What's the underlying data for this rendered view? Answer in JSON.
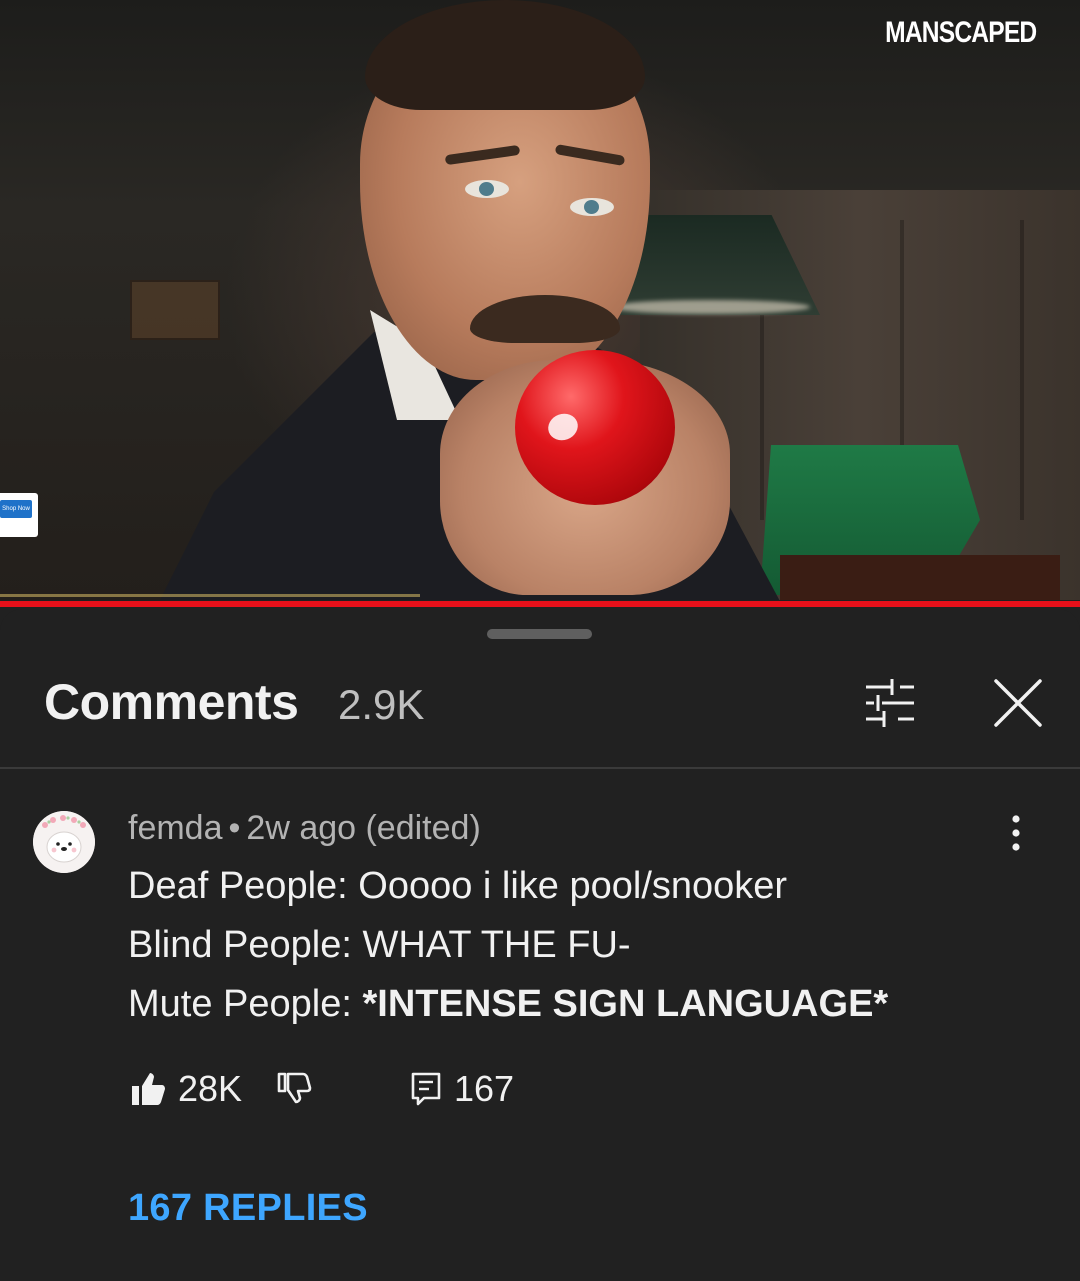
{
  "video": {
    "brand_watermark": "MANSCAPED",
    "ad_badge_text": "Shop Now",
    "progress_fraction": 1.0
  },
  "comments_panel": {
    "title": "Comments",
    "count": "2.9K",
    "filter_icon": "sort-filter-icon",
    "close_icon": "close-icon"
  },
  "comment": {
    "author": "femda",
    "separator": "•",
    "time": "2w ago (edited)",
    "lines": [
      {
        "prefix": "Deaf People: Ooooo i like pool/snooker",
        "bold": ""
      },
      {
        "prefix": "Blind People: WHAT THE FU-",
        "bold": ""
      },
      {
        "prefix": "Mute People: ",
        "bold": "*INTENSE SIGN LANGUAGE*"
      }
    ],
    "likes": "28K",
    "reply_count": "167",
    "replies_link": "167 REPLIES"
  },
  "colors": {
    "background": "#212121",
    "accent_link": "#3ea6ff",
    "progress_red": "#e8101a"
  }
}
